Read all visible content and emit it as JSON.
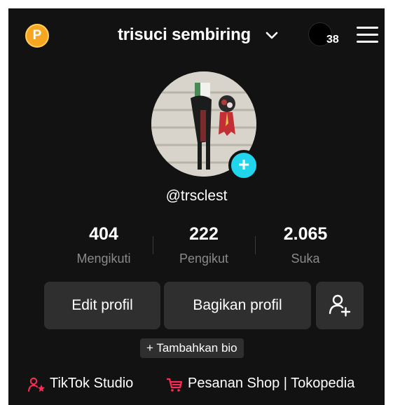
{
  "header": {
    "coin_letter": "P",
    "username_title": "trisuci sembiring",
    "notification_count": "38"
  },
  "profile": {
    "handle": "@trsclest"
  },
  "stats": [
    {
      "value": "404",
      "label": "Mengikuti"
    },
    {
      "value": "222",
      "label": "Pengikut"
    },
    {
      "value": "2.065",
      "label": "Suka"
    }
  ],
  "actions": {
    "edit_label": "Edit profil",
    "share_label": "Bagikan profil",
    "add_bio_label": "+ Tambahkan bio"
  },
  "links": {
    "studio_label": "TikTok Studio",
    "shop_label": "Pesanan Shop | Tokopedia"
  },
  "colors": {
    "background": "#121212",
    "accent_cyan": "#20d5ec",
    "link_red": "#fe2c55",
    "coin_orange": "#f6a623"
  },
  "icons": [
    "coin-icon",
    "chevron-down-icon",
    "menu-icon",
    "plus-icon",
    "add-friend-icon",
    "studio-icon",
    "cart-icon"
  ]
}
